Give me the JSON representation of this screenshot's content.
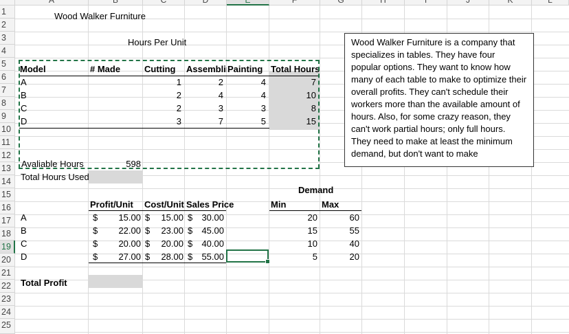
{
  "columns": [
    "A",
    "B",
    "C",
    "D",
    "E",
    "F",
    "G",
    "H",
    "I",
    "J",
    "K",
    "L"
  ],
  "rows": [
    "1",
    "2",
    "3",
    "4",
    "5",
    "6",
    "7",
    "8",
    "9",
    "10",
    "11",
    "12",
    "13",
    "14",
    "15",
    "16",
    "17",
    "18",
    "19",
    "20",
    "21",
    "22",
    "23",
    "24",
    "25"
  ],
  "selected": {
    "column": "E",
    "row": "19"
  },
  "title": "Wood Walker Furniture",
  "hours_header": "Hours Per Unit",
  "table1": {
    "headers": [
      "Model",
      "# Made",
      "Cutting",
      "Assemblir",
      "Painting",
      "Total Hours"
    ],
    "rows": [
      {
        "model": "A",
        "cutting": "1",
        "assembly": "2",
        "painting": "4",
        "total": "7"
      },
      {
        "model": "B",
        "cutting": "2",
        "assembly": "4",
        "painting": "4",
        "total": "10"
      },
      {
        "model": "C",
        "cutting": "2",
        "assembly": "3",
        "painting": "3",
        "total": "8"
      },
      {
        "model": "D",
        "cutting": "3",
        "assembly": "7",
        "painting": "5",
        "total": "15"
      }
    ]
  },
  "available_hours_label": "Avaliable Hours",
  "available_hours_value": "598",
  "total_hours_used_label": "Total Hours Used",
  "demand_header": "Demand",
  "table2": {
    "headers": [
      "Profit/Unit",
      "Cost/Unit",
      "Sales Price",
      "Min",
      "Max"
    ],
    "currency": "$",
    "rows": [
      {
        "model": "A",
        "profit": "15.00",
        "cost": "15.00",
        "price": "30.00",
        "min": "20",
        "max": "60"
      },
      {
        "model": "B",
        "profit": "22.00",
        "cost": "23.00",
        "price": "45.00",
        "min": "15",
        "max": "55"
      },
      {
        "model": "C",
        "profit": "20.00",
        "cost": "20.00",
        "price": "40.00",
        "min": "10",
        "max": "40"
      },
      {
        "model": "D",
        "profit": "27.00",
        "cost": "28.00",
        "price": "55.00",
        "min": "5",
        "max": "20"
      }
    ]
  },
  "total_profit_label": "Total Profit",
  "note_text": "Wood Walker Furniture is a company that specializes in tables. They have four popular options. They want to know how many of each table to make to optimize their overall profits. They can't schedule their workers more than the available amount of hours. Also, for some crazy reason, they can't work partial hours; only full hours. They need to make at least the minimum demand, but don't want to make",
  "colors": {
    "selection": "#217346",
    "grid": "#dadada",
    "shade": "#d9d9d9"
  }
}
